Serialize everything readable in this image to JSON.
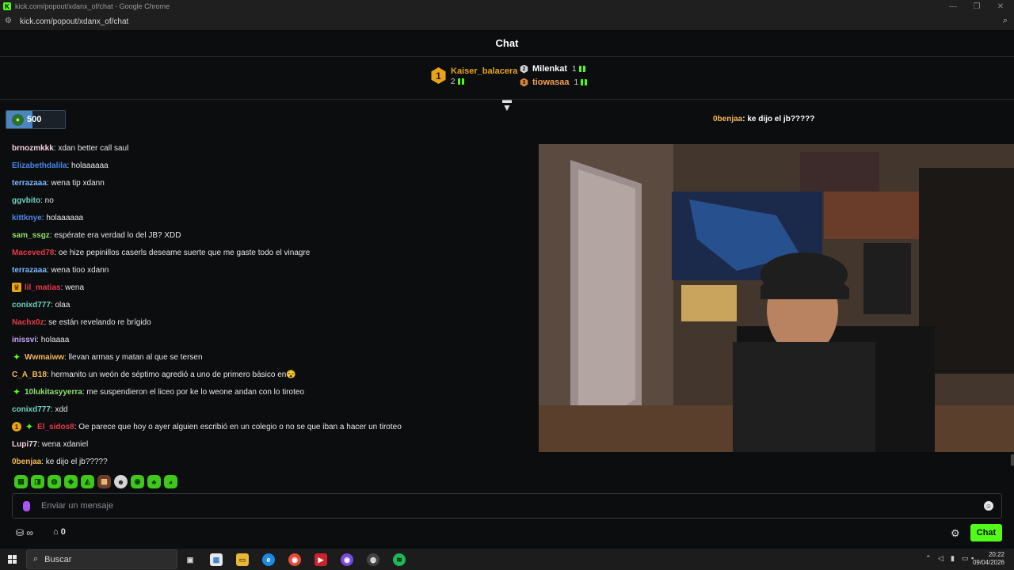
{
  "window": {
    "title": "kick.com/popout/xdanx_of/chat - Google Chrome",
    "url": "kick.com/popout/xdanx_of/chat"
  },
  "header": {
    "title": "Chat"
  },
  "leaderboard": {
    "first": {
      "rank": "1",
      "name": "Kaiser_balacera",
      "count": "2"
    },
    "second": {
      "name": "Milenkat",
      "count": "1"
    },
    "third": {
      "name": "tiowasaa",
      "count": "1"
    }
  },
  "goal": {
    "amount": "500",
    "progress_fraction": 0.45
  },
  "pinned": {
    "user": "0benjaa",
    "text": ": ke dijo el jb?????"
  },
  "messages": [
    {
      "user": "brnozmkkk",
      "text": ": xdan better call saul",
      "color": "#f5d0e0",
      "badge": ""
    },
    {
      "user": "Elizabethdalila",
      "text": ": holaaaaaa",
      "color": "#4a86e8",
      "badge": ""
    },
    {
      "user": "terrazaaa",
      "text": ": wena tip xdann",
      "color": "#7ab8ff",
      "badge": ""
    },
    {
      "user": "ggvbito",
      "text": ": no",
      "color": "#6fd3c1",
      "badge": ""
    },
    {
      "user": "kittknye",
      "text": ": holaaaaaa",
      "color": "#4a86e8",
      "badge": ""
    },
    {
      "user": "sam_ssgz",
      "text": ": espérate era verdad lo del JB? XDD",
      "color": "#8ee06a",
      "badge": ""
    },
    {
      "user": "Maceved78",
      "text": ": oe hize pepinillos caserls deseame suerte que me gaste todo el vinagre",
      "color": "#e83a4a",
      "badge": ""
    },
    {
      "user": "terrazaaa",
      "text": ": wena tioo xdann",
      "color": "#7ab8ff",
      "badge": ""
    },
    {
      "user": "lil_matias",
      "text": ": wena",
      "color": "#e83a4a",
      "badge": "crown"
    },
    {
      "user": "conixd777",
      "text": ": olaa",
      "color": "#6fd3c1",
      "badge": ""
    },
    {
      "user": "Nachx0z",
      "text": ": se están revelando re brígido",
      "color": "#e83a4a",
      "badge": ""
    },
    {
      "user": "inissvi",
      "text": ": holaaaa",
      "color": "#c8a6ff",
      "badge": ""
    },
    {
      "user": "Wwmaiww",
      "text": ": llevan armas y matan al que se tersen",
      "color": "#f5b85a",
      "badge": "spark"
    },
    {
      "user": "C_A_B18",
      "text": ": hermanito un weón de séptimo agredió a uno de primero básico en😵",
      "color": "#f5b85a",
      "badge": ""
    },
    {
      "user": "10lukitasyyerra",
      "text": ": me suspendieron el liceo por ke lo weone andan con lo tiroteo",
      "color": "#8ee06a",
      "badge": "spark"
    },
    {
      "user": "conixd777",
      "text": ": xdd",
      "color": "#6fd3c1",
      "badge": ""
    },
    {
      "user": "El_sidos8",
      "text": ": Oe parece que hoy o ayer alguien escribió en un colegio o no se que iban a hacer un tiroteo",
      "color": "#e83a4a",
      "badge": "num"
    },
    {
      "user": "Lupi77",
      "text": ": wena xdaniel",
      "color": "#f5d0e0",
      "badge": ""
    },
    {
      "user": "0benjaa",
      "text": ": ke dijo el jb?????",
      "color": "#f5b85a",
      "badge": ""
    }
  ],
  "emotes": [
    "kick-emote-1",
    "kick-emote-2",
    "kick-emote-3",
    "kick-emote-4",
    "kick-emote-5",
    "kick-emote-6",
    "kick-emote-7",
    "kick-emote-8",
    "kick-emote-9",
    "kick-emote-10"
  ],
  "input": {
    "placeholder": "Enviar un mensaje"
  },
  "footer": {
    "store_count": "0",
    "chat_button": "Chat"
  },
  "taskbar": {
    "search_label": "Buscar",
    "time": "20:22",
    "date": "09/04/2026"
  },
  "colors": {
    "accent": "#53fc18",
    "background": "#0b0d0f",
    "gold": "#e8a317"
  }
}
